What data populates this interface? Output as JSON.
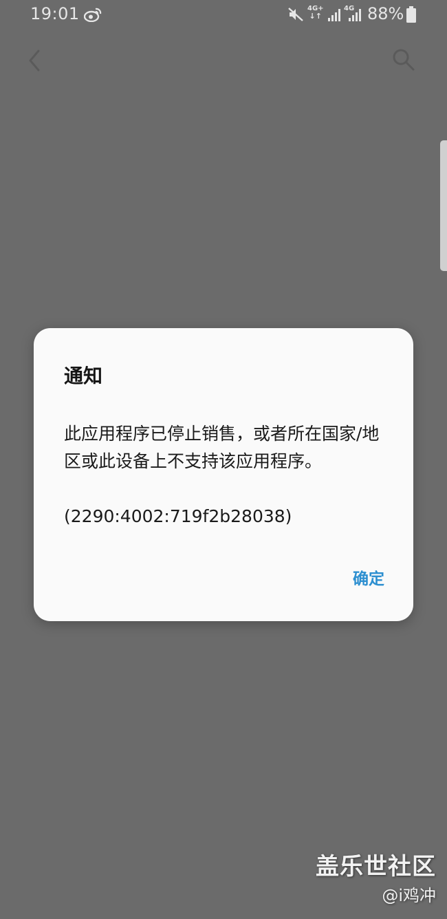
{
  "status_bar": {
    "time": "19:01",
    "network_1": {
      "label": "4G+",
      "arrows": "↓↑"
    },
    "network_2": {
      "label": "4G",
      "arrows": ""
    },
    "battery_percent": "88%",
    "icons": [
      "weibo-icon",
      "mute-icon",
      "signal-icon",
      "battery-icon"
    ]
  },
  "nav": {
    "icons": [
      "back-icon",
      "search-icon"
    ]
  },
  "dialog": {
    "title": "通知",
    "message": "此应用程序已停止销售，或者所在国家/地区或此设备上不支持该应用程序。",
    "code": "(2290:4002:719f2b28038)",
    "confirm_label": "确定",
    "accent_color": "#2d8fd0"
  },
  "watermark": {
    "title": "盖乐世社区",
    "user": "@i鸡冲"
  }
}
